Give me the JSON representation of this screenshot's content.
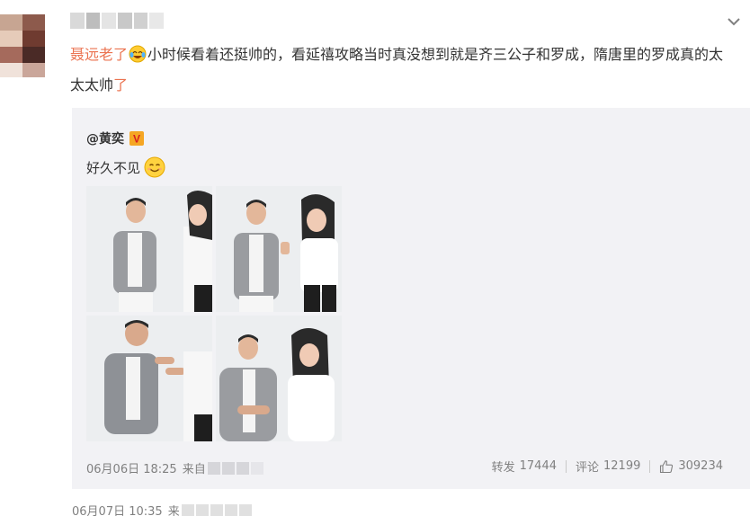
{
  "post": {
    "mention": "聂远老了",
    "text_part1": "小时候看着还挺帅的，看延禧攻略当时真没想到就是齐三公子和罗成，隋唐里的罗成真的太太太帅",
    "text_end": "了"
  },
  "repost": {
    "author": "@黄奕",
    "badge_letter": "V",
    "text": "好久不见",
    "photo_count": 4,
    "time": "06月06日 18:25",
    "source_prefix": "来自",
    "forward_label": "转发",
    "forward_count": "17444",
    "comment_label": "评论",
    "comment_count": "12199",
    "like_count": "309234"
  },
  "footer": {
    "time": "06月07日 10:35",
    "source_prefix": "来"
  },
  "icons": {
    "chevron": "chevron-down-icon",
    "laugh_cry_emoji": "laugh-cry-emoji-icon",
    "smile_emoji": "smile-emoji-icon",
    "verified": "verified-v-icon",
    "like": "thumbs-up-icon"
  },
  "colors": {
    "link": "#eb7350",
    "meta": "#808080",
    "repost_bg": "#f2f2f5",
    "verified": "#f5a623"
  }
}
